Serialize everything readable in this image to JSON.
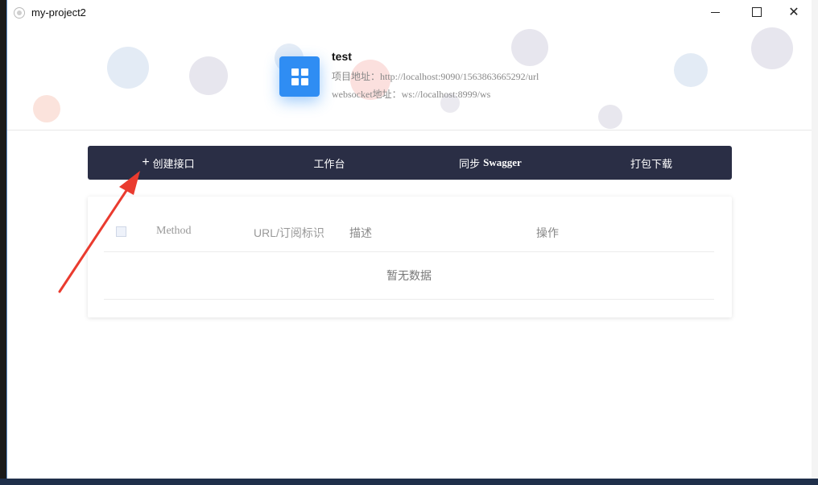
{
  "window": {
    "title": "my-project2"
  },
  "project": {
    "name": "test",
    "url_line": "项目地址：http://localhost:9090/1563863665292/url",
    "ws_line": "websocket地址：ws://localhost:8999/ws"
  },
  "nav": {
    "create_label": "创建接口",
    "workbench_label": "工作台",
    "sync_prefix": "同步",
    "sync_name": "Swagger",
    "download_label": "打包下载"
  },
  "table": {
    "columns": [
      "Method",
      "URL/订阅标识",
      "描述",
      "操作"
    ],
    "empty_text": "暂无数据"
  },
  "colors": {
    "navbar": "#2a2e45",
    "logo": "#2f8df3",
    "annotation_arrow": "#ea3b2f"
  }
}
